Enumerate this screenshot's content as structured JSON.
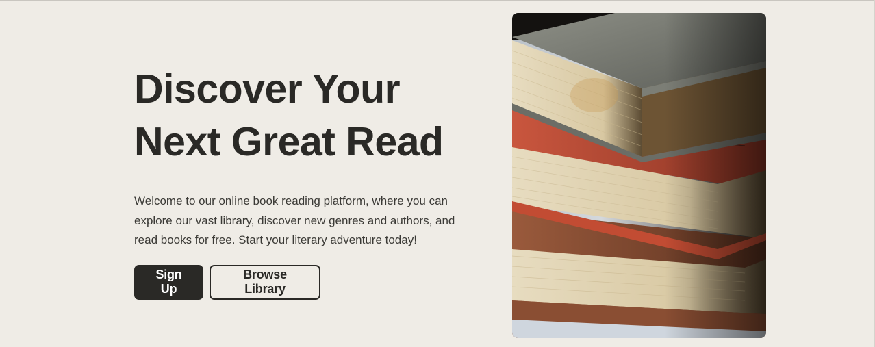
{
  "hero": {
    "title_line1": "Discover Your",
    "title_line2": "Next Great Read",
    "description": "Welcome to our online book reading platform, where you can explore our vast library, discover new genres and authors, and read books for free. Start your literary adventure today!",
    "signup_label": "Sign Up",
    "browse_label": "Browse Library"
  },
  "image": {
    "subject": "stack-of-old-books-photo"
  },
  "colors": {
    "background": "#efece6",
    "text": "#2a2926",
    "button_primary": "#2a2926",
    "button_primary_text": "#ffffff"
  }
}
